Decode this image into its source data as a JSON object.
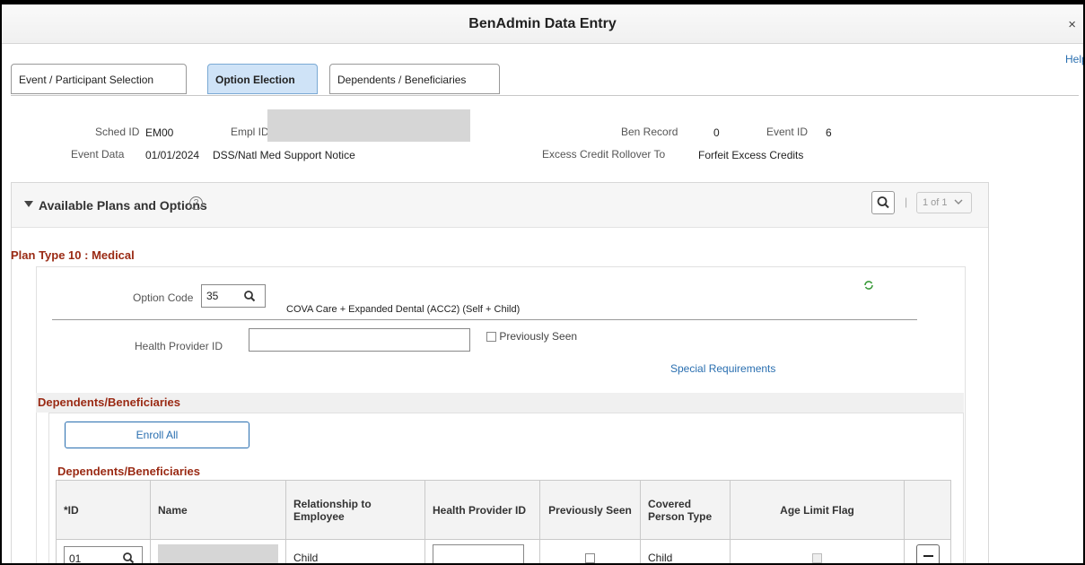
{
  "window": {
    "title": "BenAdmin Data Entry",
    "close": "×",
    "help": "Help"
  },
  "tabs": [
    {
      "label": "Event / Participant Selection"
    },
    {
      "label": "Option Election"
    },
    {
      "label": "Dependents / Beneficiaries"
    }
  ],
  "header": {
    "sched_id_label": "Sched ID",
    "sched_id": "EM00",
    "empl_id_label": "Empl ID",
    "ben_record_label": "Ben Record",
    "ben_record": "0",
    "event_id_label": "Event ID",
    "event_id": "6",
    "event_data_label": "Event Data",
    "event_date": "01/01/2024",
    "event_desc": "DSS/Natl Med Support Notice",
    "excess_label": "Excess Credit Rollover To",
    "excess_value": "Forfeit Excess Credits"
  },
  "section": {
    "title": "Available Plans and Options",
    "help_icon": "?",
    "pager": "1 of 1"
  },
  "plan": {
    "type_label": "Plan Type 10 : Medical",
    "option_code_label": "Option Code",
    "option_code": "35",
    "option_desc": "COVA Care + Expanded Dental (ACC2) (Self + Child)",
    "health_provider_label": "Health Provider ID",
    "health_provider": "",
    "previously_seen_label": "Previously Seen",
    "special_requirements": "Special Requirements"
  },
  "dependents": {
    "header": "Dependents/Beneficiaries",
    "enroll_all": "Enroll All",
    "grid_title": "Dependents/Beneficiaries",
    "columns": [
      "*ID",
      "Name",
      "Relationship to Employee",
      "Health Provider ID",
      "Previously Seen",
      "Covered Person Type",
      "Age Limit Flag",
      ""
    ],
    "rows": [
      {
        "id": "01",
        "name": "",
        "relationship": "Child",
        "covered_type": "Child"
      }
    ]
  }
}
